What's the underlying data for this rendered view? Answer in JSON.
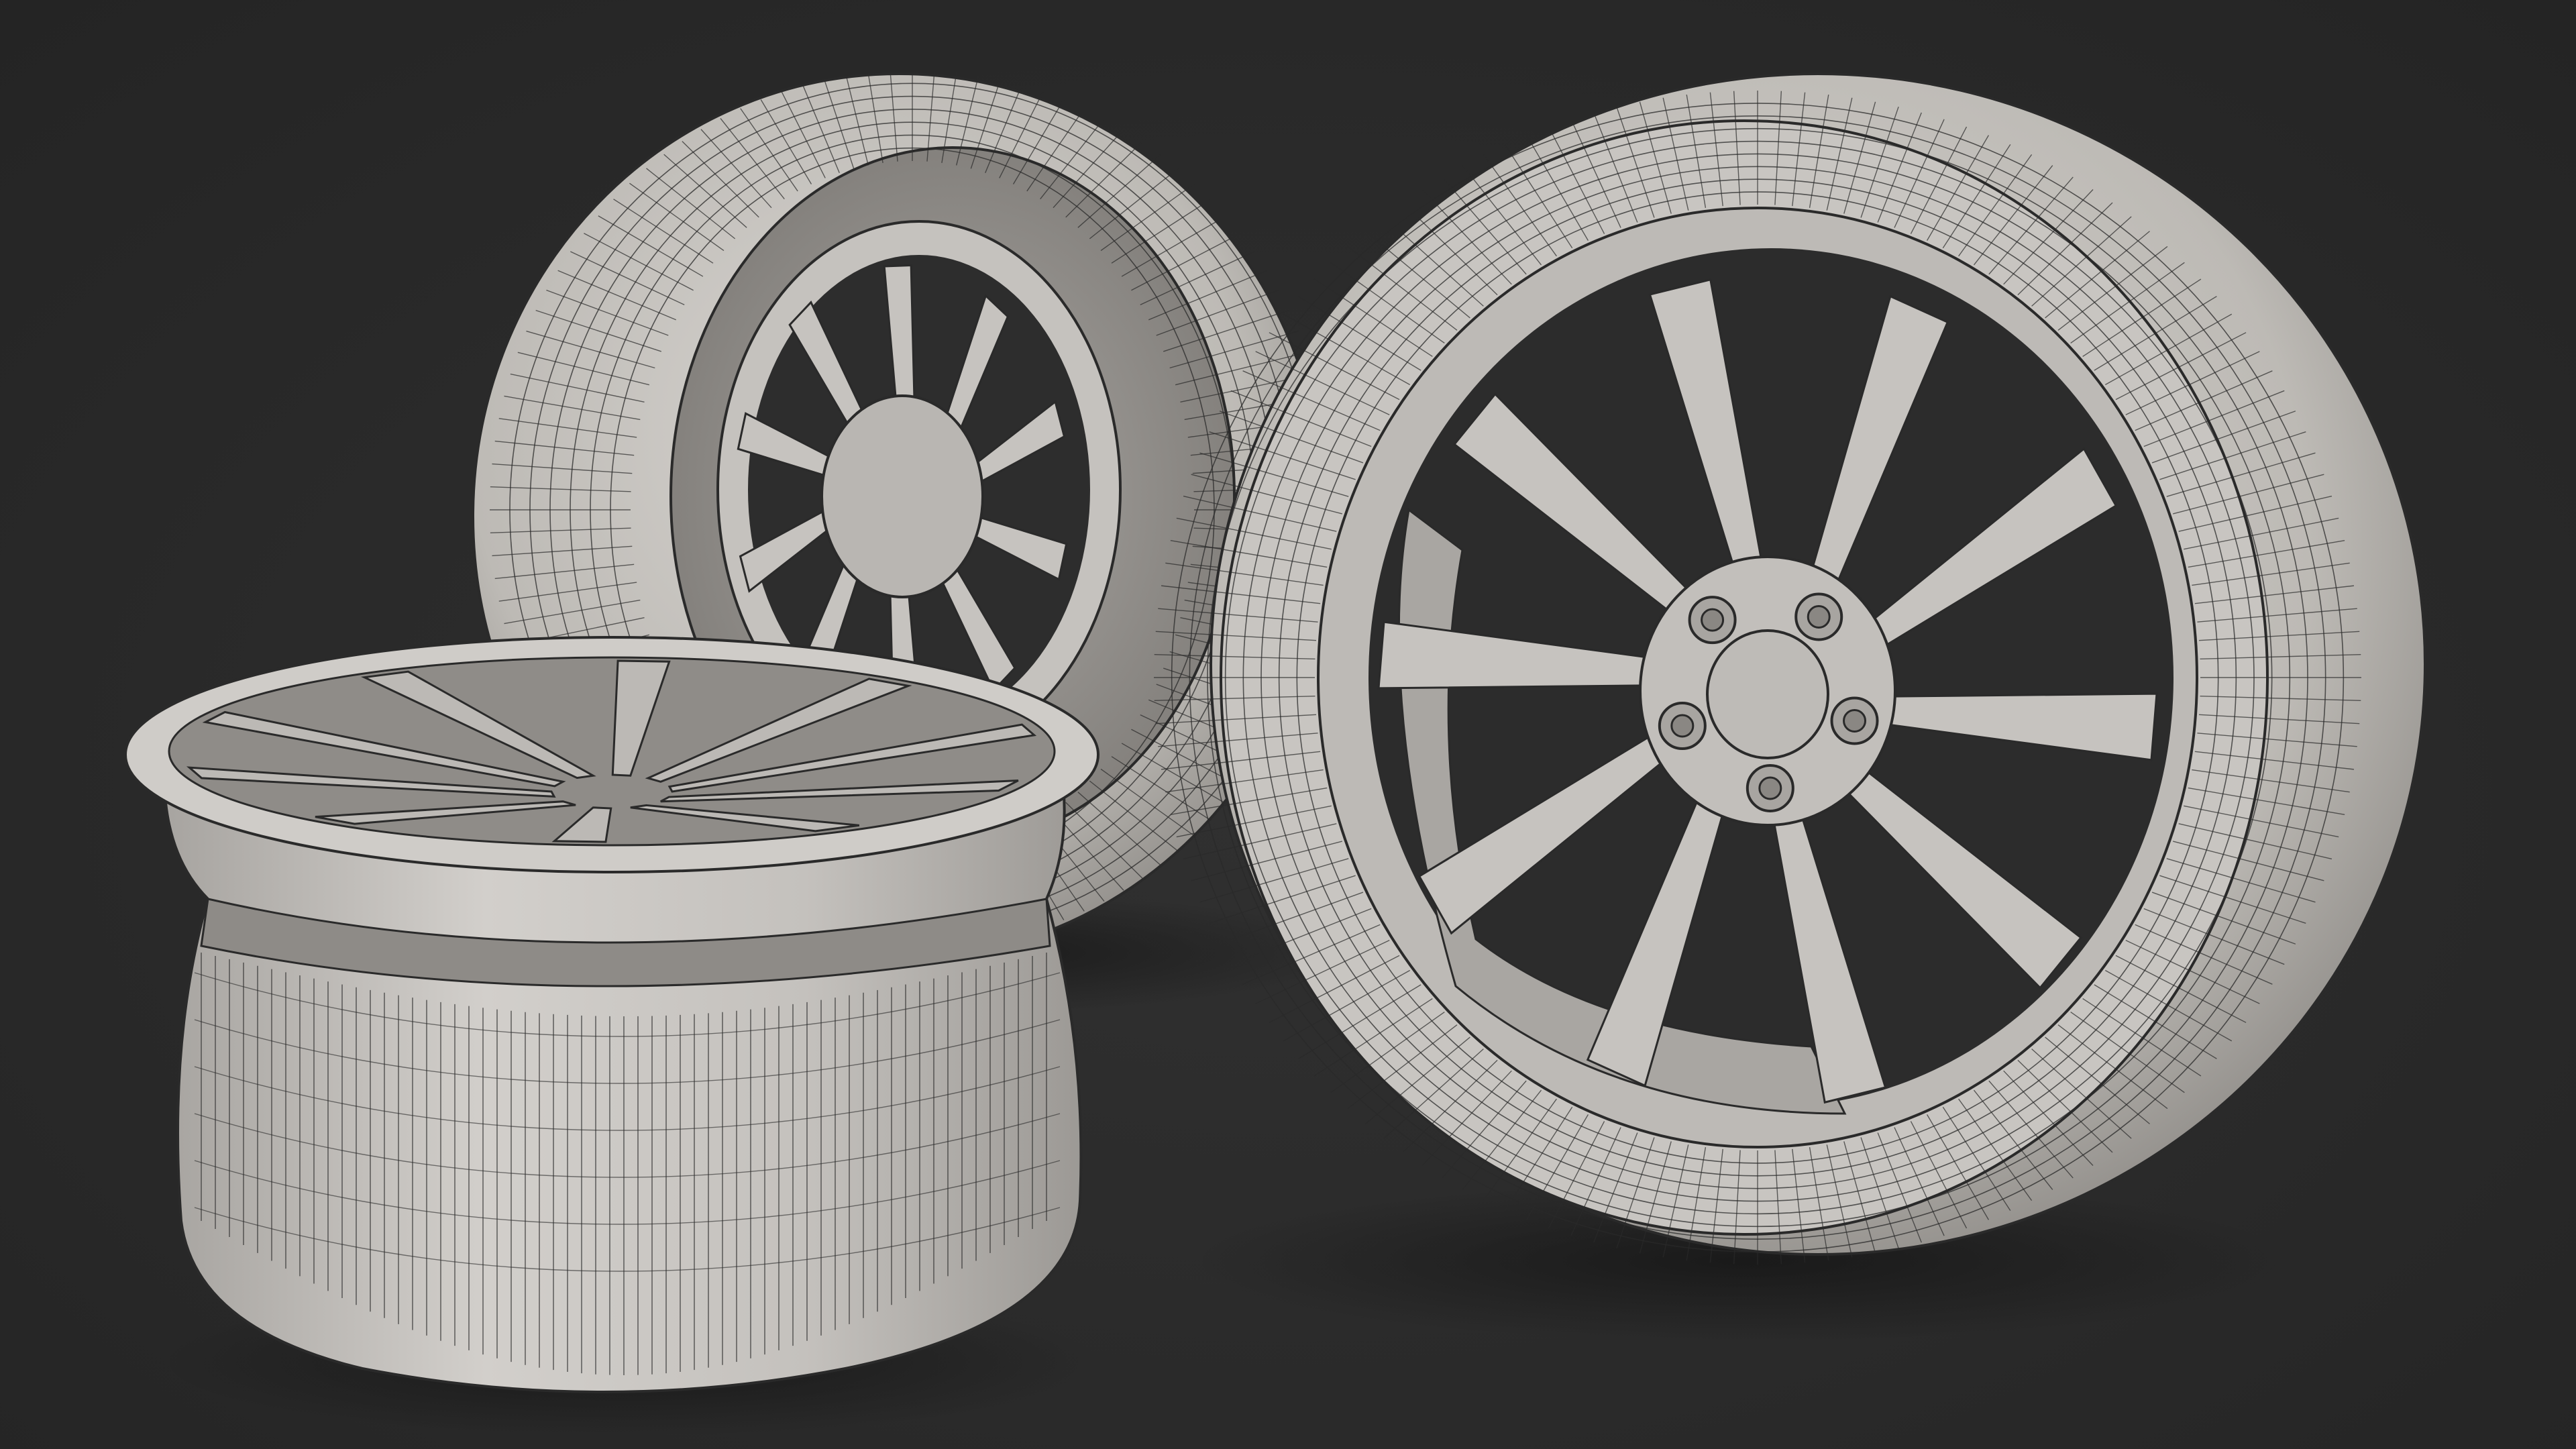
{
  "scene": {
    "background_color": "#2b2b2b",
    "surface_color": "#c9c6c2",
    "wire_color": "#2a2a2a",
    "shadow_color": "#1c1c1c",
    "objects": [
      {
        "name": "rear-tire-wheel",
        "type": "wheel-with-tire",
        "spokes": 10
      },
      {
        "name": "front-tire-wheel",
        "type": "wheel-with-tire",
        "spokes": 10,
        "lug_nuts": 5
      },
      {
        "name": "bare-rim",
        "type": "rim",
        "spokes": 10
      }
    ],
    "render_style": "clay-shaded wireframe"
  }
}
